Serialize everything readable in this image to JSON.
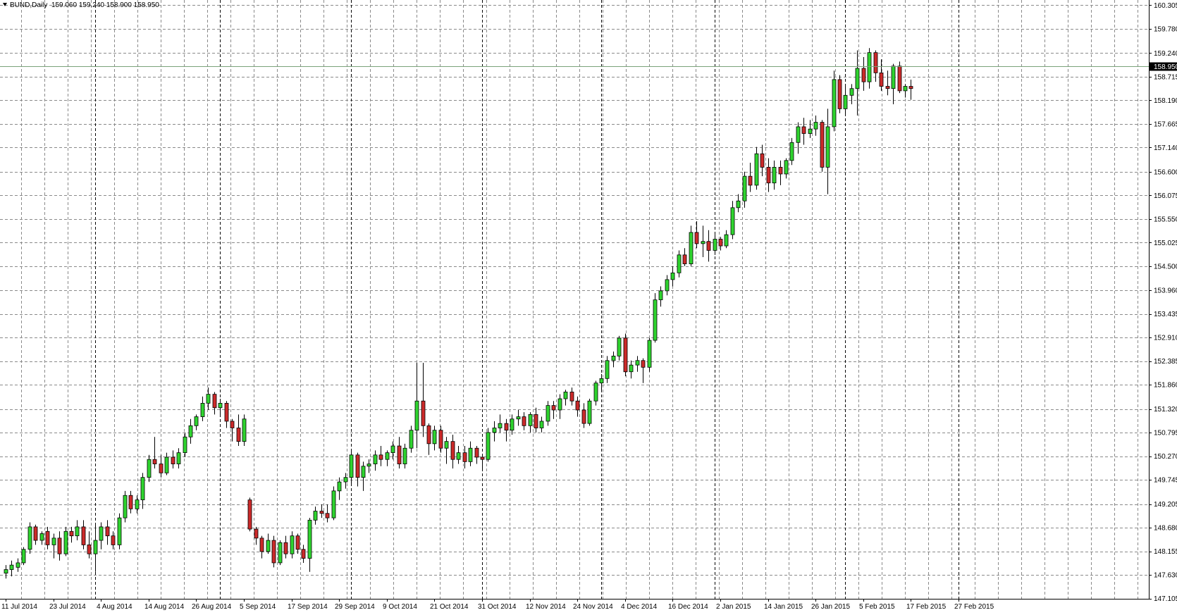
{
  "header": {
    "symbol": "BUND,Daily",
    "ohlc": "159.060 159.240 158.900 158.950"
  },
  "current_price_label": "158.950",
  "chart_data": {
    "type": "candlestick",
    "title": "BUND,Daily",
    "ylim": [
      147.1,
      160.42
    ],
    "price_ticks": [
      "160.305",
      "159.780",
      "159.240",
      "158.715",
      "158.190",
      "157.665",
      "157.140",
      "156.600",
      "156.075",
      "155.550",
      "155.025",
      "154.500",
      "153.960",
      "153.435",
      "152.910",
      "152.385",
      "151.860",
      "151.320",
      "150.795",
      "150.270",
      "149.745",
      "149.205",
      "148.680",
      "148.155",
      "147.630",
      "147.105"
    ],
    "date_ticks": [
      {
        "label": "11 Jul 2014",
        "index": 0
      },
      {
        "label": "23 Jul 2014",
        "index": 8
      },
      {
        "label": "4 Aug 2014",
        "index": 16
      },
      {
        "label": "14 Aug 2014",
        "index": 24
      },
      {
        "label": "26 Aug 2014",
        "index": 32
      },
      {
        "label": "5 Sep 2014",
        "index": 40
      },
      {
        "label": "17 Sep 2014",
        "index": 48
      },
      {
        "label": "29 Sep 2014",
        "index": 56
      },
      {
        "label": "9 Oct 2014",
        "index": 64
      },
      {
        "label": "21 Oct 2014",
        "index": 72
      },
      {
        "label": "31 Oct 2014",
        "index": 80
      },
      {
        "label": "12 Nov 2014",
        "index": 88
      },
      {
        "label": "24 Nov 2014",
        "index": 96
      },
      {
        "label": "4 Dec 2014",
        "index": 104
      },
      {
        "label": "16 Dec 2014",
        "index": 112
      },
      {
        "label": "2 Jan 2015",
        "index": 120
      },
      {
        "label": "14 Jan 2015",
        "index": 128
      },
      {
        "label": "26 Jan 2015",
        "index": 136
      },
      {
        "label": "5 Feb 2015",
        "index": 144
      },
      {
        "label": "17 Feb 2015",
        "index": 152
      },
      {
        "label": "27 Feb 2015",
        "index": 160
      }
    ],
    "separator_indices": [
      15,
      36,
      58,
      80,
      100,
      119,
      141,
      160
    ],
    "current_price": 158.95,
    "colors": {
      "up": "#2fd42f",
      "down": "#cc2a2a",
      "wick": "#000000",
      "grid": "#8a8a8a",
      "price_line": "#7aa37a"
    },
    "candles": [
      [
        147.67,
        147.85,
        147.55,
        147.75
      ],
      [
        147.75,
        147.95,
        147.6,
        147.85
      ],
      [
        147.8,
        148.0,
        147.7,
        147.9
      ],
      [
        147.9,
        148.25,
        147.85,
        148.2
      ],
      [
        148.2,
        148.8,
        148.1,
        148.7
      ],
      [
        148.7,
        148.75,
        148.3,
        148.4
      ],
      [
        148.4,
        148.6,
        148.3,
        148.55
      ],
      [
        148.6,
        148.7,
        148.2,
        148.3
      ],
      [
        148.3,
        148.55,
        148.0,
        148.45
      ],
      [
        148.45,
        148.6,
        147.95,
        148.1
      ],
      [
        148.1,
        148.7,
        148.05,
        148.6
      ],
      [
        148.6,
        148.7,
        148.35,
        148.5
      ],
      [
        148.5,
        148.85,
        148.4,
        148.7
      ],
      [
        148.7,
        148.85,
        148.2,
        148.3
      ],
      [
        148.3,
        148.6,
        148.0,
        148.1
      ],
      [
        148.1,
        148.75,
        147.7,
        148.4
      ],
      [
        148.4,
        148.8,
        148.2,
        148.7
      ],
      [
        148.7,
        148.85,
        148.3,
        148.5
      ],
      [
        148.5,
        148.6,
        148.2,
        148.3
      ],
      [
        148.3,
        149.0,
        148.2,
        148.9
      ],
      [
        148.9,
        149.5,
        148.8,
        149.4
      ],
      [
        149.4,
        149.5,
        149.0,
        149.1
      ],
      [
        149.1,
        149.4,
        149.0,
        149.3
      ],
      [
        149.3,
        149.9,
        149.1,
        149.8
      ],
      [
        149.8,
        150.3,
        149.7,
        150.2
      ],
      [
        150.2,
        150.7,
        150.0,
        150.1
      ],
      [
        150.1,
        150.3,
        149.8,
        149.9
      ],
      [
        149.9,
        150.35,
        149.85,
        150.25
      ],
      [
        150.25,
        150.4,
        150.0,
        150.1
      ],
      [
        150.1,
        150.45,
        150.0,
        150.35
      ],
      [
        150.35,
        150.8,
        150.25,
        150.7
      ],
      [
        150.7,
        151.1,
        150.55,
        150.95
      ],
      [
        150.95,
        151.2,
        150.85,
        151.15
      ],
      [
        151.15,
        151.6,
        151.05,
        151.45
      ],
      [
        151.45,
        151.8,
        151.3,
        151.65
      ],
      [
        151.65,
        151.7,
        151.2,
        151.35
      ],
      [
        151.35,
        151.55,
        151.2,
        151.45
      ],
      [
        151.45,
        151.5,
        150.9,
        151.05
      ],
      [
        151.05,
        151.1,
        150.6,
        150.9
      ],
      [
        150.9,
        151.2,
        150.5,
        150.6
      ],
      [
        150.6,
        151.2,
        150.5,
        151.1
      ],
      [
        149.3,
        149.35,
        148.6,
        148.65
      ],
      [
        148.65,
        148.7,
        148.3,
        148.45
      ],
      [
        148.45,
        148.5,
        148.0,
        148.15
      ],
      [
        148.15,
        148.55,
        148.1,
        148.4
      ],
      [
        148.4,
        148.5,
        147.8,
        147.9
      ],
      [
        147.9,
        148.4,
        147.85,
        148.35
      ],
      [
        148.35,
        148.5,
        148.0,
        148.1
      ],
      [
        148.1,
        148.6,
        148.0,
        148.5
      ],
      [
        148.5,
        148.55,
        148.1,
        148.2
      ],
      [
        148.2,
        148.3,
        147.9,
        148.0
      ],
      [
        148.0,
        148.9,
        147.7,
        148.85
      ],
      [
        148.85,
        149.15,
        148.75,
        149.05
      ],
      [
        149.05,
        149.2,
        148.9,
        149.0
      ],
      [
        149.0,
        149.2,
        148.8,
        148.9
      ],
      [
        148.9,
        149.6,
        148.85,
        149.5
      ],
      [
        149.5,
        149.8,
        149.3,
        149.7
      ],
      [
        149.7,
        149.9,
        149.55,
        149.8
      ],
      [
        149.8,
        150.4,
        149.65,
        150.3
      ],
      [
        150.3,
        150.35,
        149.6,
        149.8
      ],
      [
        149.8,
        150.15,
        149.5,
        150.05
      ],
      [
        150.05,
        150.2,
        149.9,
        150.1
      ],
      [
        150.1,
        150.4,
        149.95,
        150.3
      ],
      [
        150.3,
        150.5,
        150.05,
        150.2
      ],
      [
        150.2,
        150.4,
        150.05,
        150.35
      ],
      [
        150.35,
        150.6,
        150.2,
        150.5
      ],
      [
        150.5,
        150.7,
        150.0,
        150.1
      ],
      [
        150.1,
        150.55,
        150.0,
        150.45
      ],
      [
        150.45,
        150.95,
        150.35,
        150.85
      ],
      [
        150.85,
        152.35,
        150.45,
        151.5
      ],
      [
        151.5,
        152.35,
        150.7,
        150.95
      ],
      [
        150.95,
        151.0,
        150.3,
        150.55
      ],
      [
        150.55,
        150.95,
        150.4,
        150.85
      ],
      [
        150.85,
        150.95,
        150.35,
        150.45
      ],
      [
        150.45,
        150.7,
        150.1,
        150.6
      ],
      [
        150.6,
        150.75,
        150.0,
        150.2
      ],
      [
        150.2,
        150.5,
        150.1,
        150.35
      ],
      [
        150.35,
        150.5,
        150.0,
        150.15
      ],
      [
        150.15,
        150.6,
        150.05,
        150.45
      ],
      [
        150.45,
        150.5,
        150.1,
        150.25
      ],
      [
        150.25,
        150.3,
        150.0,
        150.2
      ],
      [
        150.2,
        150.9,
        150.15,
        150.8
      ],
      [
        150.8,
        151.05,
        150.6,
        150.9
      ],
      [
        150.9,
        151.2,
        150.8,
        151.0
      ],
      [
        151.0,
        151.1,
        150.6,
        150.85
      ],
      [
        150.85,
        151.2,
        150.75,
        151.1
      ],
      [
        151.1,
        151.3,
        150.95,
        151.15
      ],
      [
        151.15,
        151.25,
        150.85,
        150.95
      ],
      [
        150.95,
        151.25,
        150.8,
        151.2
      ],
      [
        151.2,
        151.35,
        150.8,
        150.9
      ],
      [
        150.9,
        151.15,
        150.8,
        151.05
      ],
      [
        151.05,
        151.5,
        150.95,
        151.4
      ],
      [
        151.4,
        151.5,
        151.1,
        151.3
      ],
      [
        151.3,
        151.65,
        151.1,
        151.55
      ],
      [
        151.55,
        151.75,
        151.4,
        151.7
      ],
      [
        151.7,
        151.8,
        151.4,
        151.5
      ],
      [
        151.5,
        151.6,
        151.15,
        151.3
      ],
      [
        151.3,
        151.45,
        150.9,
        151.0
      ],
      [
        151.0,
        151.55,
        150.95,
        151.5
      ],
      [
        151.5,
        151.95,
        151.4,
        151.9
      ],
      [
        151.9,
        152.1,
        151.7,
        152.0
      ],
      [
        152.0,
        152.5,
        151.9,
        152.4
      ],
      [
        152.4,
        152.6,
        152.25,
        152.5
      ],
      [
        152.5,
        152.95,
        152.4,
        152.9
      ],
      [
        152.9,
        153.0,
        152.05,
        152.15
      ],
      [
        152.15,
        152.4,
        152.0,
        152.3
      ],
      [
        152.3,
        152.5,
        152.15,
        152.4
      ],
      [
        152.4,
        152.45,
        151.9,
        152.25
      ],
      [
        152.25,
        152.9,
        152.15,
        152.85
      ],
      [
        152.85,
        153.9,
        152.8,
        153.75
      ],
      [
        153.75,
        154.05,
        153.6,
        153.95
      ],
      [
        153.95,
        154.3,
        153.85,
        154.2
      ],
      [
        154.2,
        154.5,
        154.05,
        154.35
      ],
      [
        154.35,
        154.85,
        154.25,
        154.75
      ],
      [
        154.75,
        154.9,
        154.5,
        154.55
      ],
      [
        154.55,
        155.4,
        154.5,
        155.25
      ],
      [
        155.25,
        155.5,
        154.9,
        155.0
      ],
      [
        155.0,
        155.4,
        154.7,
        155.05
      ],
      [
        155.05,
        155.3,
        154.6,
        154.85
      ],
      [
        154.85,
        155.2,
        154.75,
        155.1
      ],
      [
        155.1,
        155.15,
        154.85,
        154.95
      ],
      [
        154.95,
        155.3,
        154.9,
        155.2
      ],
      [
        155.2,
        155.95,
        155.1,
        155.8
      ],
      [
        155.8,
        156.1,
        155.7,
        155.95
      ],
      [
        155.95,
        156.6,
        155.8,
        156.5
      ],
      [
        156.5,
        156.8,
        156.15,
        156.3
      ],
      [
        156.3,
        157.15,
        156.2,
        157.0
      ],
      [
        157.0,
        157.2,
        156.5,
        156.7
      ],
      [
        156.7,
        156.9,
        156.15,
        156.35
      ],
      [
        156.35,
        156.85,
        156.2,
        156.7
      ],
      [
        156.7,
        156.85,
        156.3,
        156.55
      ],
      [
        156.55,
        156.9,
        156.45,
        156.85
      ],
      [
        156.85,
        157.35,
        156.75,
        157.25
      ],
      [
        157.25,
        157.7,
        157.0,
        157.6
      ],
      [
        157.6,
        157.8,
        157.2,
        157.45
      ],
      [
        157.45,
        157.75,
        157.35,
        157.55
      ],
      [
        157.55,
        157.85,
        157.4,
        157.7
      ],
      [
        157.7,
        157.75,
        156.6,
        156.7
      ],
      [
        156.7,
        158.0,
        156.1,
        157.6
      ],
      [
        157.6,
        158.85,
        157.5,
        158.65
      ],
      [
        158.65,
        158.75,
        157.9,
        158.0
      ],
      [
        158.0,
        158.5,
        157.85,
        158.3
      ],
      [
        158.3,
        158.55,
        158.1,
        158.45
      ],
      [
        158.45,
        159.3,
        157.85,
        158.9
      ],
      [
        158.9,
        159.15,
        158.4,
        158.6
      ],
      [
        158.6,
        159.35,
        158.45,
        159.25
      ],
      [
        159.25,
        159.3,
        158.6,
        158.8
      ],
      [
        158.8,
        159.1,
        158.4,
        158.5
      ],
      [
        158.5,
        158.85,
        158.3,
        158.45
      ],
      [
        158.45,
        159.0,
        158.1,
        158.95
      ],
      [
        158.95,
        159.05,
        158.35,
        158.4
      ],
      [
        158.4,
        158.55,
        158.25,
        158.5
      ],
      [
        158.5,
        158.65,
        158.2,
        158.45
      ]
    ]
  }
}
